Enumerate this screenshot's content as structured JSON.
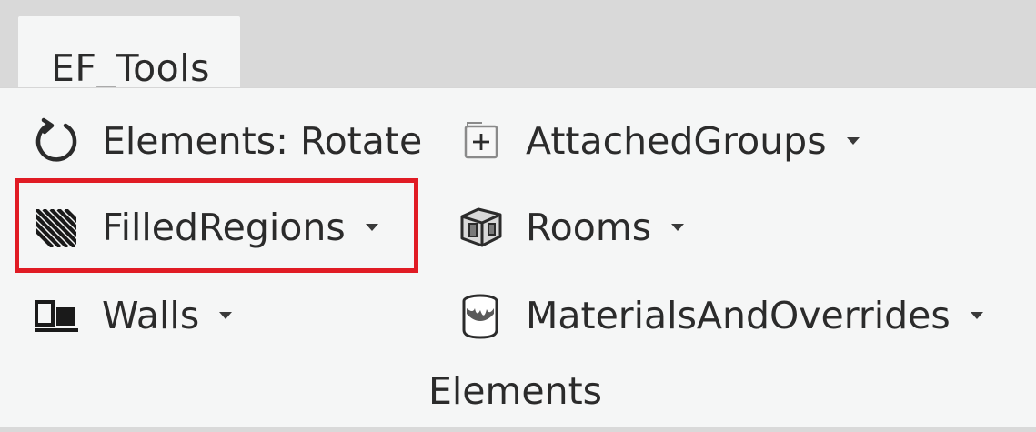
{
  "tab": {
    "label": "EF_Tools"
  },
  "panel": {
    "title": "Elements",
    "buttons": {
      "rotate": {
        "label": "Elements: Rotate",
        "icon": "rotate-icon"
      },
      "filled_regions": {
        "label": "FilledRegions",
        "icon": "hatch-pattern-icon",
        "dropdown": true
      },
      "walls": {
        "label": "Walls",
        "icon": "wall-icon",
        "dropdown": true
      },
      "attached_groups": {
        "label": "AttachedGroups",
        "icon": "group-add-icon",
        "dropdown": true
      },
      "rooms": {
        "label": "Rooms",
        "icon": "room-icon",
        "dropdown": true
      },
      "materials": {
        "label": "MaterialsAndOverrides",
        "icon": "paint-bucket-icon",
        "dropdown": true
      }
    }
  },
  "highlight_color": "#e01b24"
}
